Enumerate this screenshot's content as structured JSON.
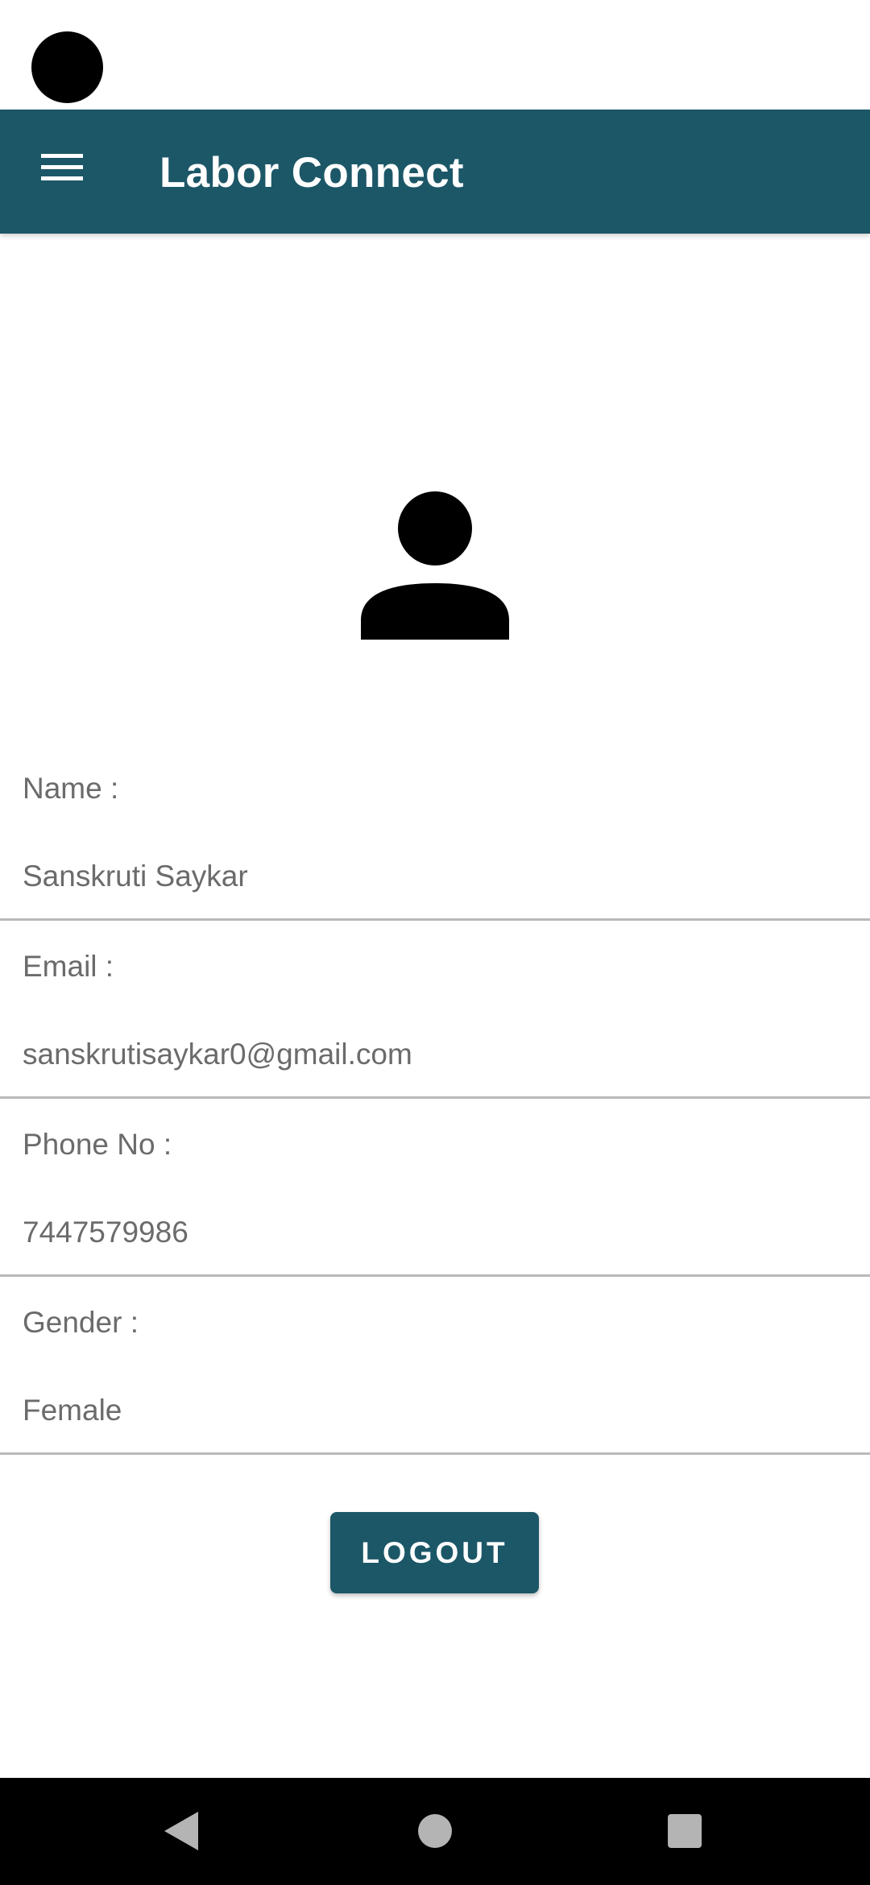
{
  "app_bar": {
    "title": "Labor Connect",
    "color": "#1c5767",
    "menu_icon": "hamburger-menu-icon"
  },
  "profile": {
    "avatar_icon": "person-icon",
    "fields": [
      {
        "label": "Name :",
        "value": "Sanskruti Saykar"
      },
      {
        "label": "Email :",
        "value": "sanskrutisaykar0@gmail.com"
      },
      {
        "label": "Phone No :",
        "value": "7447579986"
      },
      {
        "label": "Gender :",
        "value": "Female"
      }
    ]
  },
  "logout_button": {
    "label": "LOGOUT",
    "color": "#1c5767"
  },
  "nav_bar": {
    "icons": [
      "back-icon",
      "home-icon",
      "recents-icon"
    ]
  }
}
